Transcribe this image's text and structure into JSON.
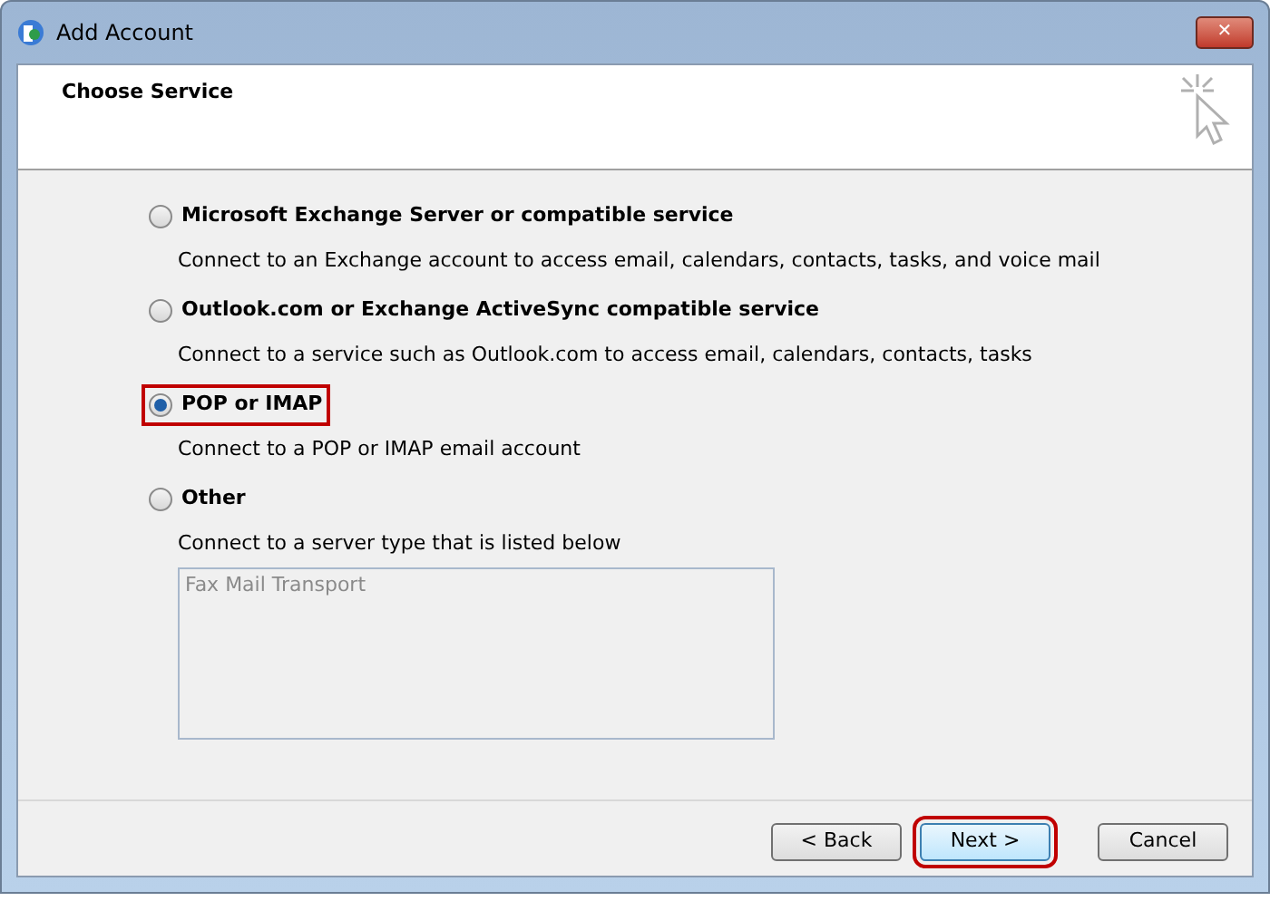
{
  "window": {
    "title": "Add Account",
    "close": "✕"
  },
  "header": {
    "title": "Choose Service"
  },
  "options": [
    {
      "label": "Microsoft Exchange Server or compatible service",
      "description": "Connect to an Exchange account to access email, calendars, contacts, tasks, and voice mail",
      "selected": false,
      "highlighted": false
    },
    {
      "label": "Outlook.com or Exchange ActiveSync compatible service",
      "description": "Connect to a service such as Outlook.com to access email, calendars, contacts, tasks",
      "selected": false,
      "highlighted": false
    },
    {
      "label": "POP or IMAP",
      "description": "Connect to a POP or IMAP email account",
      "selected": true,
      "highlighted": true
    },
    {
      "label": "Other",
      "description": "Connect to a server type that is listed below",
      "selected": false,
      "highlighted": false,
      "list": [
        "Fax Mail Transport"
      ]
    }
  ],
  "buttons": [
    {
      "label": "< Back",
      "highlighted": false
    },
    {
      "label": "Next >",
      "highlighted": true
    },
    {
      "label": "Cancel",
      "highlighted": false
    }
  ]
}
